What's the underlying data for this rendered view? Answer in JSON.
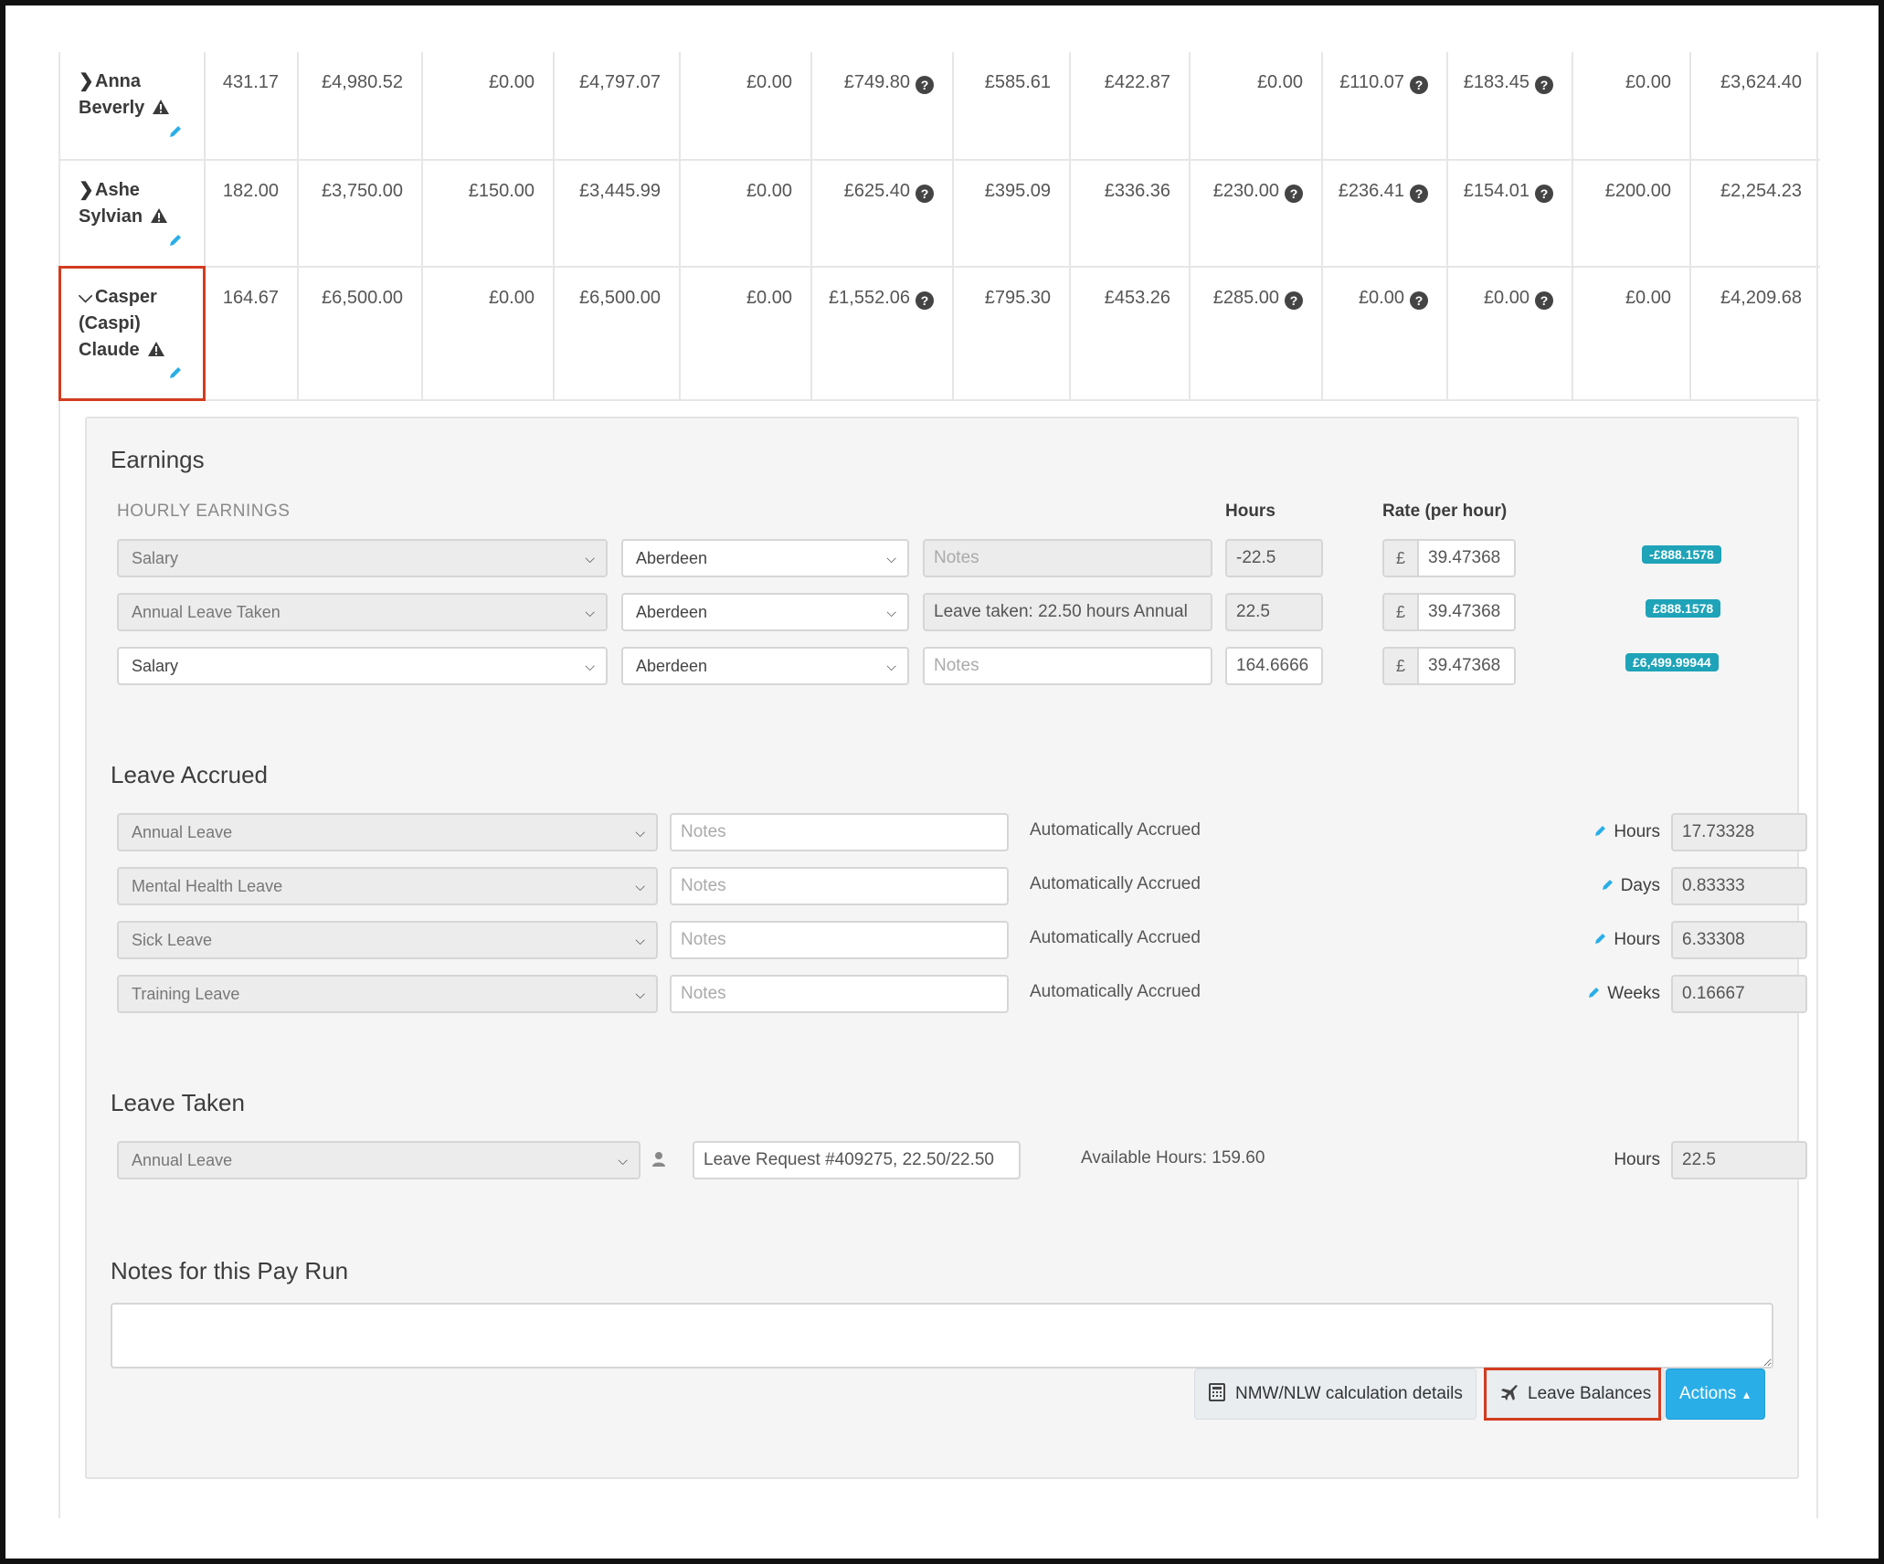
{
  "employees": [
    {
      "first": "Anna",
      "last": "Beverly",
      "values": [
        "431.17",
        "£4,980.52",
        "£0.00",
        "£4,797.07",
        "£0.00",
        "£749.80",
        "£585.61",
        "£422.87",
        "£0.00",
        "£110.07",
        "£183.45",
        "£0.00",
        "£3,624.40"
      ]
    },
    {
      "first": "Ashe",
      "last": "Sylvian",
      "values": [
        "182.00",
        "£3,750.00",
        "£150.00",
        "£3,445.99",
        "£0.00",
        "£625.40",
        "£395.09",
        "£336.36",
        "£230.00",
        "£236.41",
        "£154.01",
        "£200.00",
        "£2,254.23"
      ]
    },
    {
      "line1": "Casper",
      "line2": "(Caspi)",
      "line3": "Claude",
      "values": [
        "164.67",
        "£6,500.00",
        "£0.00",
        "£6,500.00",
        "£0.00",
        "£1,552.06",
        "£795.30",
        "£453.26",
        "£285.00",
        "£0.00",
        "£0.00",
        "£0.00",
        "£4,209.68"
      ]
    }
  ],
  "help_glyph": "?",
  "earnings": {
    "title": "Earnings",
    "subtitle": "HOURLY EARNINGS",
    "hours_header": "Hours",
    "rate_header": "Rate (per hour)",
    "currency": "£",
    "rows": [
      {
        "type": "Salary",
        "location": "Aberdeen",
        "notes": "Notes",
        "hours": "-22.5",
        "rate": "39.47368",
        "amount": "-£888.1578"
      },
      {
        "type": "Annual Leave Taken",
        "location": "Aberdeen",
        "notes": "Leave taken: 22.50 hours Annual",
        "hours": "22.5",
        "rate": "39.47368",
        "amount": "£888.1578"
      },
      {
        "type": "Salary",
        "location": "Aberdeen",
        "notes": "Notes",
        "hours": "164.6666",
        "rate": "39.47368",
        "amount": "£6,499.99944"
      }
    ]
  },
  "leave_accrued": {
    "title": "Leave Accrued",
    "rows": [
      {
        "type": "Annual Leave",
        "notes": "Notes",
        "status": "Automatically Accrued",
        "unit": "Hours",
        "value": "17.73328"
      },
      {
        "type": "Mental Health Leave",
        "notes": "Notes",
        "status": "Automatically Accrued",
        "unit": "Days",
        "value": "0.83333"
      },
      {
        "type": "Sick Leave",
        "notes": "Notes",
        "status": "Automatically Accrued",
        "unit": "Hours",
        "value": "6.33308"
      },
      {
        "type": "Training Leave",
        "notes": "Notes",
        "status": "Automatically Accrued",
        "unit": "Weeks",
        "value": "0.16667"
      }
    ]
  },
  "leave_taken": {
    "title": "Leave Taken",
    "type": "Annual Leave",
    "request": "Leave Request #409275, 22.50/22.50",
    "available": "Available Hours: 159.60",
    "unit": "Hours",
    "value": "22.5"
  },
  "notes_section": {
    "title": "Notes for this Pay Run"
  },
  "buttons": {
    "nmw": "NMW/NLW calculation details",
    "leave_balances": "Leave Balances",
    "actions": "Actions"
  },
  "colors": {
    "accent": "#2aaee8",
    "badge": "#1ea3b8",
    "highlight": "#d33c1f"
  }
}
